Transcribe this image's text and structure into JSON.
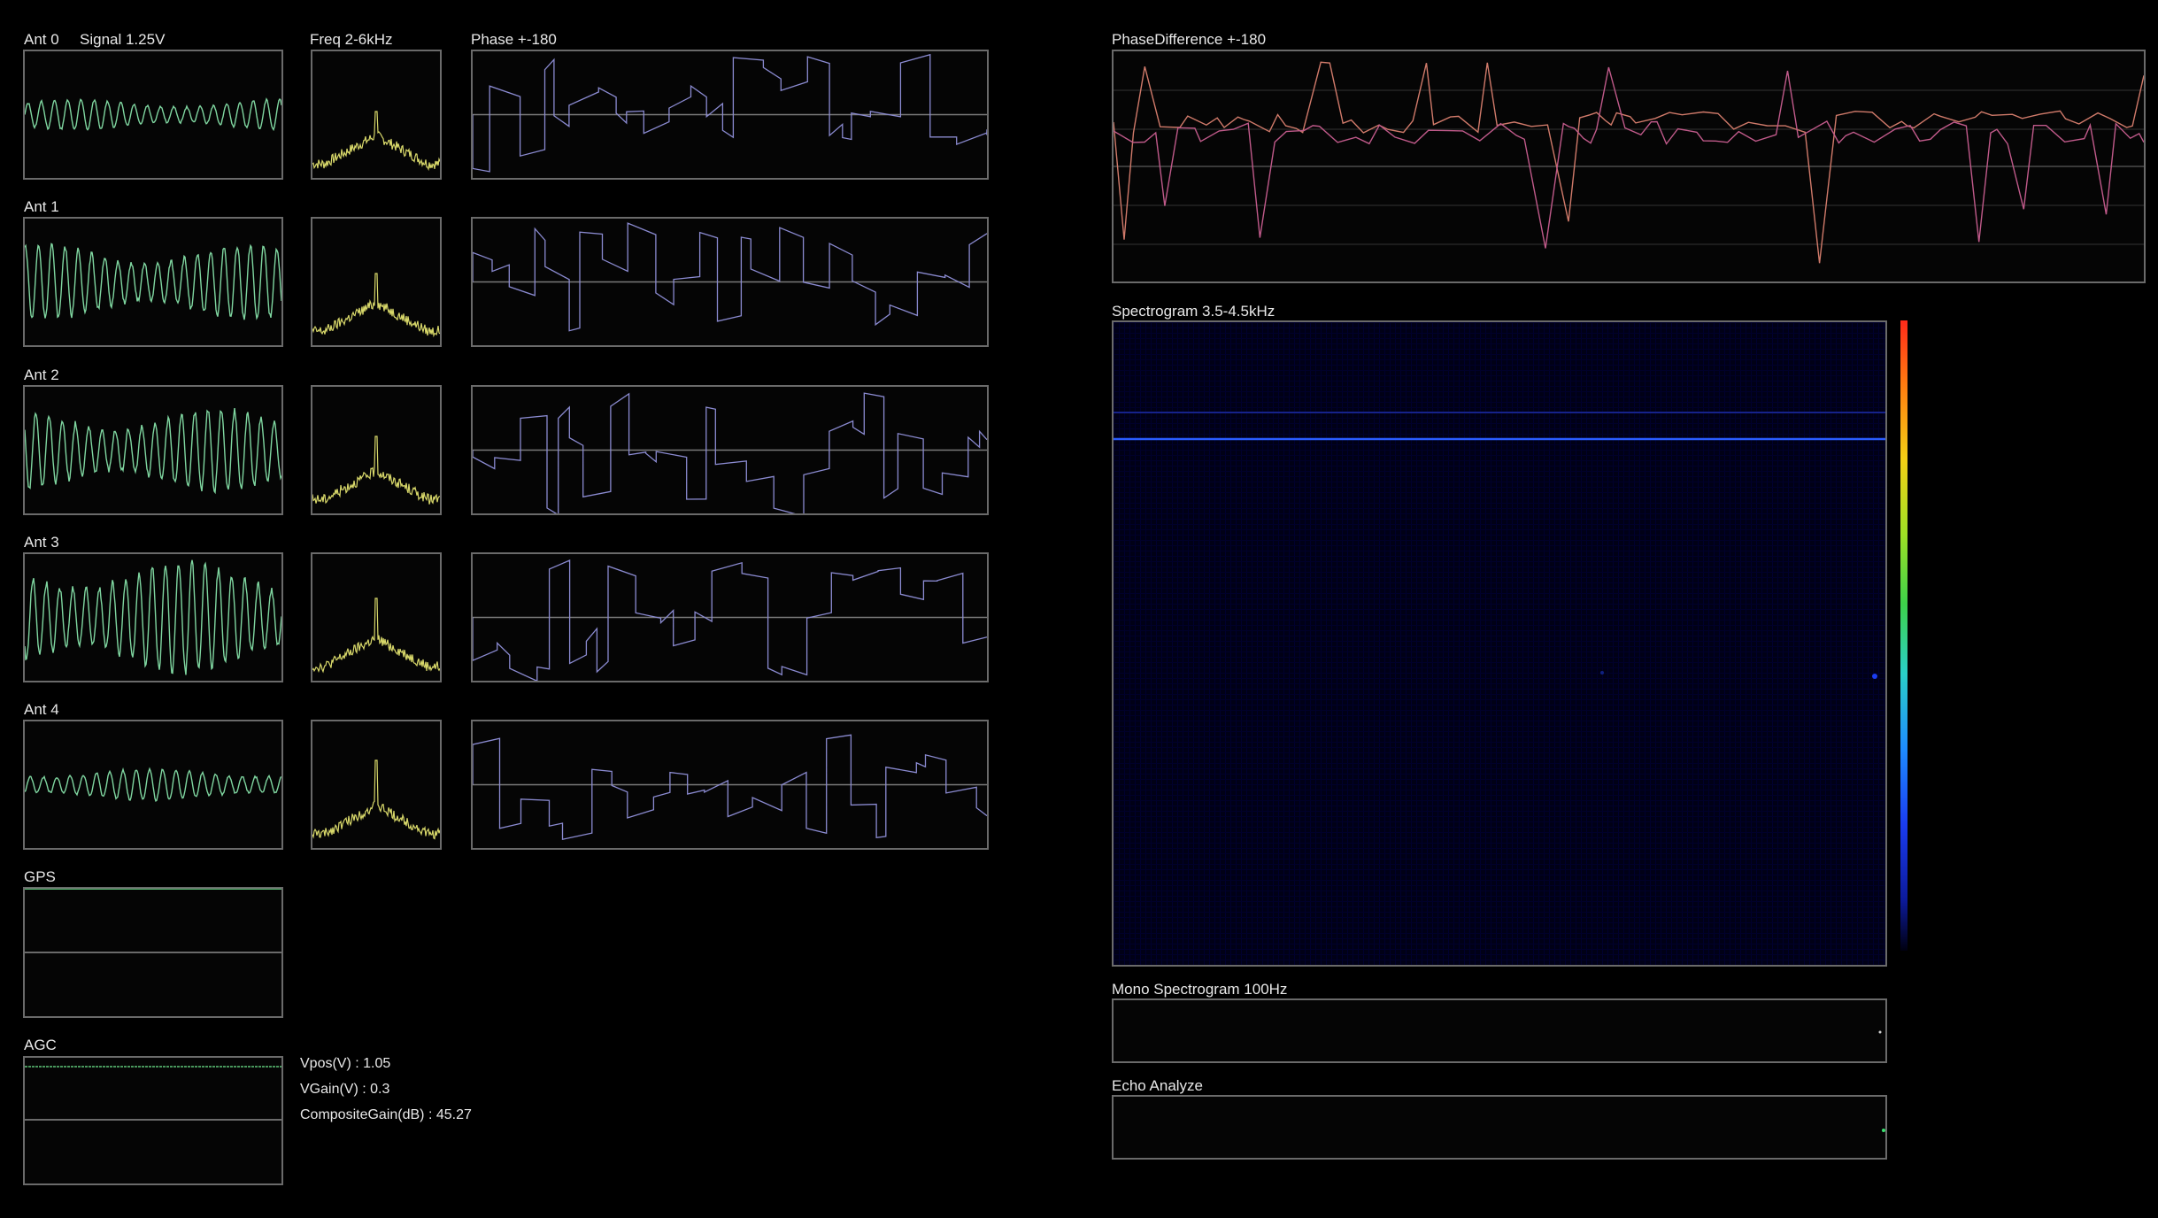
{
  "antennas": [
    {
      "label": "Ant 0",
      "signal_amp": 0.25
    },
    {
      "label": "Ant 1",
      "signal_amp": 0.62
    },
    {
      "label": "Ant 2",
      "signal_amp": 0.68
    },
    {
      "label": "Ant 3",
      "signal_amp": 0.92
    },
    {
      "label": "Ant 4",
      "signal_amp": 0.26
    }
  ],
  "headers": {
    "signal": "Signal 1.25V",
    "freq": "Freq 2-6kHz",
    "phase": "Phase +-180",
    "phase_difference": "PhaseDifference +-180",
    "spectrogram": "Spectrogram 3.5-4.5kHz",
    "mono_spectrogram": "Mono Spectrogram 100Hz",
    "echo": "Echo Analyze",
    "gps": "GPS",
    "agc": "AGC"
  },
  "agc": {
    "vpos": "Vpos(V) : 1.05",
    "vgain": "VGain(V) : 0.3",
    "composite_gain": "CompositeGain(dB) : 45.27"
  },
  "colors": {
    "signal": "#7fd6a0",
    "freq": "#d8d86a",
    "phase": "#8a8ad0",
    "phase_diff_a": "#d07a6a",
    "phase_diff_b": "#c05a8a",
    "spectro_line": "#2a5cff",
    "gps_line": "#5fc77a"
  }
}
